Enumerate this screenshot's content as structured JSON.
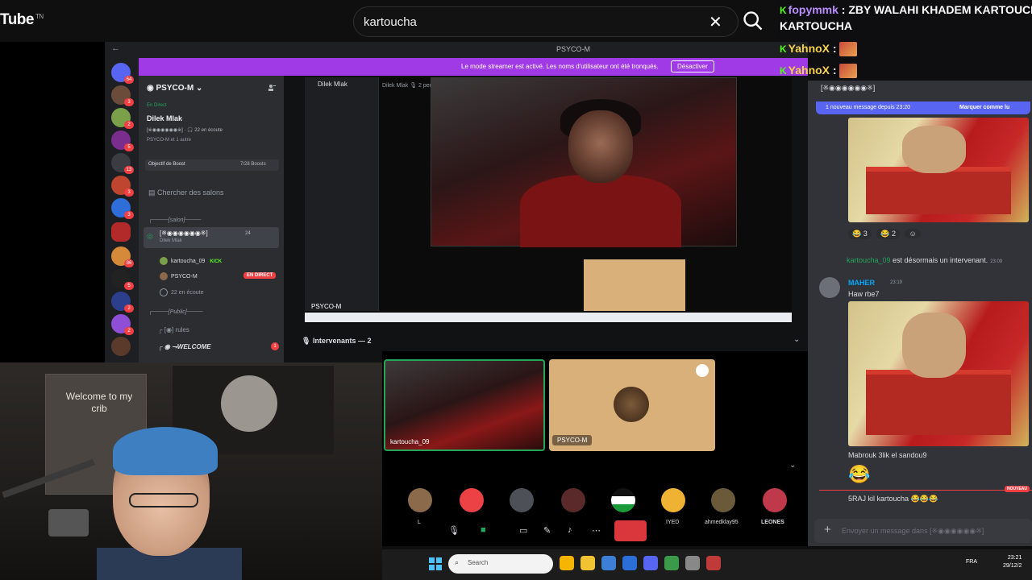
{
  "youtube": {
    "logo": "Tube",
    "logo_suffix": "TN",
    "search_value": "kartoucha"
  },
  "discord": {
    "window_title": "PSYCO-M",
    "streamer_banner": "Le mode streamer est activé. Les noms d'utilisateur ont été tronqués.",
    "streamer_disable": "Désactiver",
    "guild_name": "PSYCO-M",
    "live_label": "En Direct",
    "stage_title": "Dilek Mlak",
    "stage_sub": "[※◉◉◉◉◉◉※] · 🎧 22 en écoute",
    "stage_sub2": "PSYCO-M et 1 autre",
    "boost_label": "Objectif de Boost",
    "boost_count": "7/28 Boosts",
    "search_channels": "Chercher des salons",
    "cat_salon": "┌────[salon]────",
    "active_channel": "[※◉◉◉◉◉◉※]",
    "active_channel_sub": "Dilek Mlak",
    "active_channel_count": "24",
    "members": [
      {
        "name": "kartoucha_09",
        "tag": "KICK"
      },
      {
        "name": "PSYCO-M",
        "tag": "EN DIRECT"
      },
      {
        "name": "22 en écoute",
        "tag": ""
      }
    ],
    "cat_public": "┌────[Public]────",
    "channel_rules": "┌ [◉] rules",
    "channel_welcome": "┌ ◉ ⇁WELCOME",
    "welcome_badge": "1",
    "stage_topbar": "Dilek Mlak   🎙 2 personnes en train de parler  🎧 22 en écoute",
    "nested_label": "PSYCO-M",
    "intervenants": "Intervenants — 2"
  },
  "stream_chat": [
    {
      "user": "fopymmk",
      "message": "ZBY WALAHI KHADEM KARTOUCHA"
    },
    {
      "user": "YahnoX",
      "message": ""
    },
    {
      "user": "YahnoX",
      "message": ""
    }
  ],
  "right_chat": {
    "header": "[※◉◉◉◉◉◉※]",
    "new_msg": "1 nouveau message depuis 23:20",
    "mark_read": "Marquer comme lu",
    "reactions": [
      "😂 3",
      "😂 2"
    ],
    "system_user": "kartoucha_09",
    "system_text": " est désormais un intervenant.",
    "system_time": "23:09",
    "maher_name": "MAHER",
    "maher_time": "23:19",
    "maher_msg": "Haw rbe7",
    "mabrouk": "Mabrouk 3lik el sandou9",
    "laugh": "😂",
    "new_tag": "NOUVEAU",
    "sraj": "5RAJ kil kartoucha 😂😂😂",
    "placeholder": "Envoyer un message dans [※◉◉◉◉◉◉※]"
  },
  "call": {
    "tile1_label": "kartoucha_09",
    "tile2_label": "PSYCO-M",
    "bottom_labels": [
      "L",
      "IYED",
      "ahmedklay95",
      "LEONES"
    ]
  },
  "webcam": {
    "poster_text": "Welcome to my crib"
  },
  "taskbar": {
    "search": "Search",
    "lang": "FRA",
    "time": "23:21",
    "date": "29/12/2"
  },
  "colors": {
    "discord_bg": "#313338",
    "streamer_purple": "#a03ae6",
    "kick_green": "#53fc18",
    "live_red": "#f23f43",
    "blurple": "#5865f2"
  }
}
